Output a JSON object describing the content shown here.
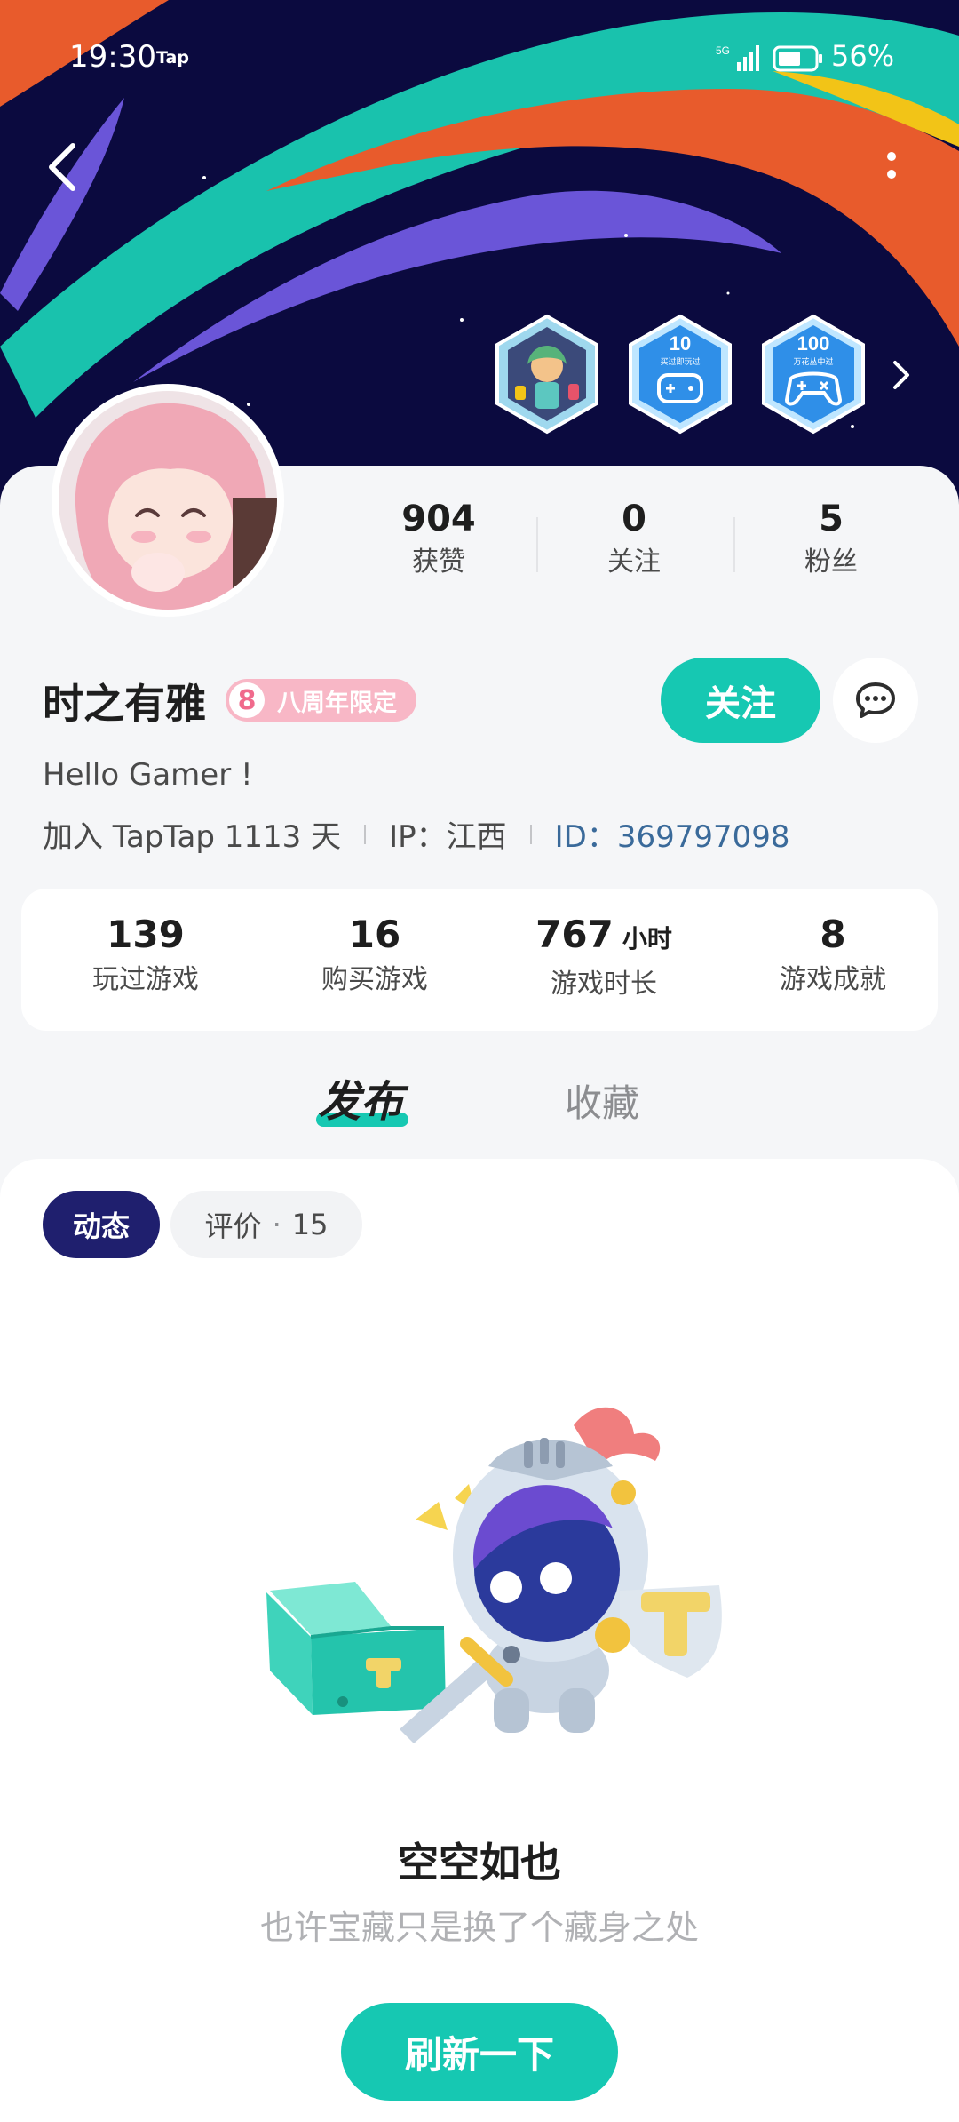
{
  "status_bar": {
    "time": "19:30",
    "app_mark": "Tap",
    "network": "5G",
    "battery_percent": "56%"
  },
  "header": {
    "back_icon": "chevron-left-icon",
    "more_icon": "more-vertical-icon"
  },
  "badges": [
    {
      "icon": "anime-character-badge-icon"
    },
    {
      "number": "10",
      "caption": "买过即玩过",
      "icon": "gamepad-icon"
    },
    {
      "number": "100",
      "caption": "万花丛中过",
      "icon": "gamepad-icon"
    }
  ],
  "profile_stats": [
    {
      "value": "904",
      "label": "获赞"
    },
    {
      "value": "0",
      "label": "关注"
    },
    {
      "value": "5",
      "label": "粉丝"
    }
  ],
  "user": {
    "name": "时之有雅",
    "tag_number": "8",
    "tag_label": "八周年限定",
    "bio": "Hello Gamer !",
    "join_text": "加入 TapTap 1113 天",
    "ip": "IP：江西",
    "id_prefix": "ID：",
    "id_value": "369797098"
  },
  "actions": {
    "follow_label": "关注",
    "chat_icon": "chat-bubble-icon"
  },
  "game_stats": [
    {
      "value": "139",
      "unit": "",
      "label": "玩过游戏"
    },
    {
      "value": "16",
      "unit": "",
      "label": "购买游戏"
    },
    {
      "value": "767",
      "unit": "小时",
      "label": "游戏时长"
    },
    {
      "value": "8",
      "unit": "",
      "label": "游戏成就"
    }
  ],
  "tabs": {
    "publish": "发布",
    "collect": "收藏"
  },
  "filters": {
    "active": "动态",
    "review_label": "评价",
    "review_dot": "·",
    "review_count": "15"
  },
  "empty_state": {
    "title": "空空如也",
    "subtitle": "也许宝藏只是换了个藏身之处",
    "button": "刷新一下"
  },
  "colors": {
    "accent": "#16c8b2",
    "banner_bg": "#0b0a3f",
    "chip_active": "#1f1f6e"
  }
}
